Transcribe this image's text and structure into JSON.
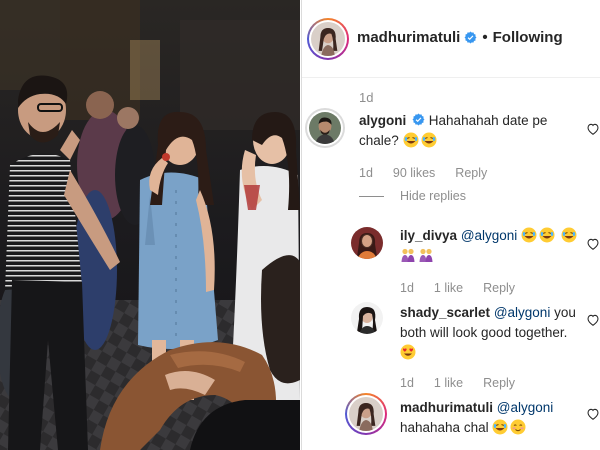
{
  "post": {
    "author": "madhurimatuli",
    "separator": "•",
    "follow_status": "Following",
    "timestamp": "1d"
  },
  "comments": [
    {
      "user": "alygoni",
      "verified": true,
      "text": "Hahahahah date pe chale?",
      "emojis": [
        "laughing-emoji",
        "laughing-emoji"
      ],
      "time": "1d",
      "likes": "90 likes",
      "reply_label": "Reply",
      "hide_replies": "Hide replies"
    }
  ],
  "replies": [
    {
      "user": "ily_divya",
      "mention": "@alygoni",
      "text": "",
      "emojis": [
        "laughing-emoji",
        "laughing-emoji",
        "laughing-emoji",
        "couple-emoji",
        "couple-emoji"
      ],
      "time": "1d",
      "likes": "1 like",
      "reply_label": "Reply"
    },
    {
      "user": "shady_scarlet",
      "mention": "@alygoni",
      "text": "you both will look good together.",
      "emojis": [
        "heart-eyes-emoji"
      ],
      "time": "1d",
      "likes": "1 like",
      "reply_label": "Reply"
    },
    {
      "user": "madhurimatuli",
      "mention": "@alygoni",
      "text": "hahahaha chal",
      "emojis": [
        "laughing-emoji",
        "blush-emoji"
      ]
    }
  ],
  "colors": {
    "text": "#262626",
    "muted": "#8e8e8e",
    "mention": "#00376b",
    "verified": "#3897f0",
    "photo_bg": "#1b1a1d"
  },
  "icons": [
    "verified-badge-icon",
    "heart-outline-icon"
  ]
}
